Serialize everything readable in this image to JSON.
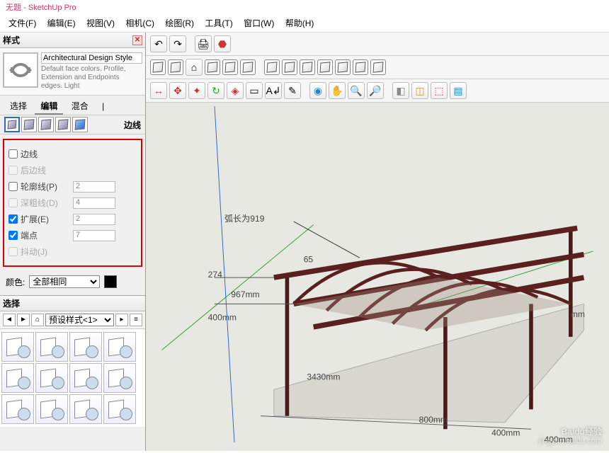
{
  "title": "无题 - SketchUp Pro",
  "menu": {
    "file": "文件(F)",
    "edit": "编辑(E)",
    "view": "视图(V)",
    "camera": "相机(C)",
    "draw": "绘图(R)",
    "tools": "工具(T)",
    "window": "窗口(W)",
    "help": "帮助(H)"
  },
  "styles_panel": {
    "title": "样式",
    "style_name": "Architectural Design Style",
    "style_desc": "Default face colors. Profile, Extension and Endpoints edges. Light",
    "tabs": {
      "select": "选择",
      "edit": "编辑",
      "mix": "混合"
    },
    "edges_label": "边线",
    "edge_opts": {
      "edges": "边线",
      "back_edges": "后边线",
      "profiles": "轮廓线(P)",
      "depth_cue": "深粗线(D)",
      "extension": "扩展(E)",
      "endpoints": "端点",
      "jitter": "抖动(J)"
    },
    "edge_vals": {
      "profiles": "2",
      "depth_cue": "4",
      "extension": "2",
      "endpoints": "7"
    },
    "color_label": "颜色:",
    "color_option": "全部相同"
  },
  "select_panel": {
    "title": "选择",
    "preset_combo": "预设样式<1>"
  },
  "drawing": {
    "arc_label": "弧长为919",
    "dims": {
      "d_274": "274",
      "d_65": "65",
      "d_967": "967mm",
      "d_400l": "400mm",
      "d_3430": "3430mm",
      "d_800": "800mm",
      "d_400r": "400mm",
      "d_right": "mm",
      "d_br": "400mm"
    }
  },
  "watermark": {
    "brand": "Baidu经验",
    "url": "jingyan.baidu.com"
  }
}
